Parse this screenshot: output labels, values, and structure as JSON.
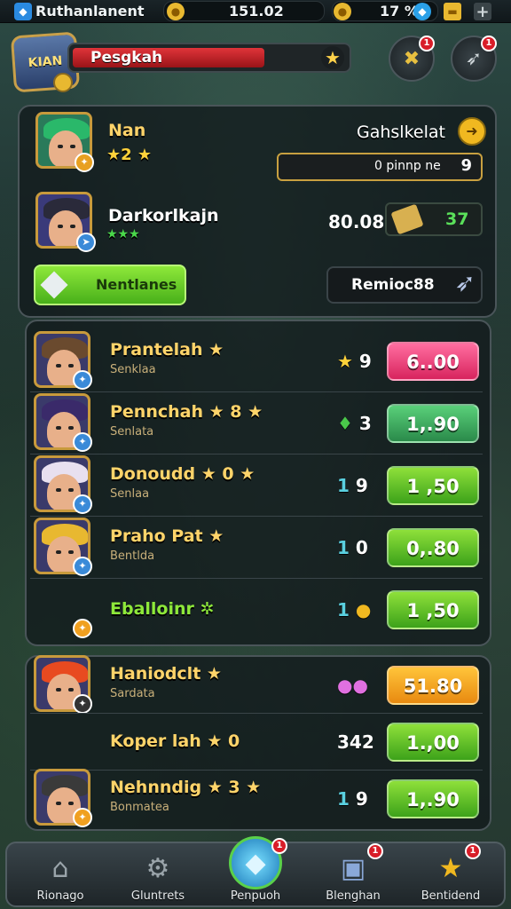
{
  "topbar": {
    "player_name": "Ruthanlanent",
    "gold": "151.02",
    "gems": "17 %",
    "add_label": "+"
  },
  "header": {
    "badge_label": "KIAN",
    "bar_label": "Pesgkah",
    "bar_fill_fraction": 0.72,
    "notif_count_1": "1",
    "notif_count_2": "1"
  },
  "featured": {
    "hero1": {
      "name": "Nan",
      "stars": "★2 ★"
    },
    "panel_title": "Gahslkelat",
    "input_value": "0  pinnp ne",
    "input_icon": "9",
    "hero2": {
      "name": "Darkorlkajn",
      "stars": "★★★"
    },
    "hero2_value": "80.08",
    "hero2_count": "37",
    "green_button": "Nentlanes",
    "dark_button": "Remioc88"
  },
  "list1": [
    {
      "name": "Prantelah ★",
      "sub": "Senklaa",
      "cost_icon": "★",
      "cost": "9",
      "price": "6..00",
      "btn": "pink",
      "hair": "#6a4a2e",
      "lvl_color": "#3a8ad8"
    },
    {
      "name": "Pennchah ★ 8 ★",
      "sub": "Senlata",
      "cost_icon": "♦",
      "cost": "3",
      "price": "1,.90",
      "btn": "teal",
      "hair": "#3a2a6a",
      "lvl_color": "#3a8ad8"
    },
    {
      "name": "Donoudd ★ 0 ★",
      "sub": "Senlaa",
      "cost_icon": "1",
      "cost": "9",
      "price": "1 ,50",
      "btn": "green",
      "hair": "#e8e0f0",
      "lvl_color": "#3a8ad8"
    },
    {
      "name": "Praho Pat ★",
      "sub": "Bentlda",
      "cost_icon": "1",
      "cost": "0",
      "price": "0,.80",
      "btn": "green",
      "hair": "#e8b830",
      "lvl_color": "#3a8ad8"
    },
    {
      "name": "Eballoinr ✲",
      "sub": "",
      "cost_icon": "1",
      "cost": "●",
      "price": "1 ,50",
      "btn": "green",
      "hair": "",
      "lvl_color": "#f0a020"
    }
  ],
  "list2": [
    {
      "name": "Haniodclt ★",
      "sub": "Sardata",
      "cost_icon": "",
      "cost": "●●",
      "price": "51.80",
      "btn": "orange",
      "hair": "#e84a20",
      "lvl_color": "#333"
    },
    {
      "name": "Koper lah ★ 0",
      "sub": "",
      "cost_icon": "",
      "cost": "342",
      "price": "1.,00",
      "btn": "green",
      "hair": "",
      "lvl_color": ""
    },
    {
      "name": "Nehnndig ★ 3 ★",
      "sub": "Bonmatea",
      "cost_icon": "1",
      "cost": "9",
      "price": "1,.90",
      "btn": "green",
      "hair": "#3a3a3a",
      "lvl_color": "#f0a020"
    }
  ],
  "nav": [
    {
      "label": "Rionago",
      "icon": "⌂"
    },
    {
      "label": "Gluntrets",
      "icon": "⚙"
    },
    {
      "label": "Penpuoh",
      "icon": "◆",
      "badge": "1"
    },
    {
      "label": "Blenghan",
      "icon": "▣",
      "badge": "1"
    },
    {
      "label": "Bentidend",
      "icon": "★",
      "badge": "1"
    }
  ],
  "colors": {
    "accent_gold": "#ffd46a",
    "green_button": "#5bc42a",
    "pink_button": "#e8346e",
    "orange_button": "#f5a020"
  }
}
